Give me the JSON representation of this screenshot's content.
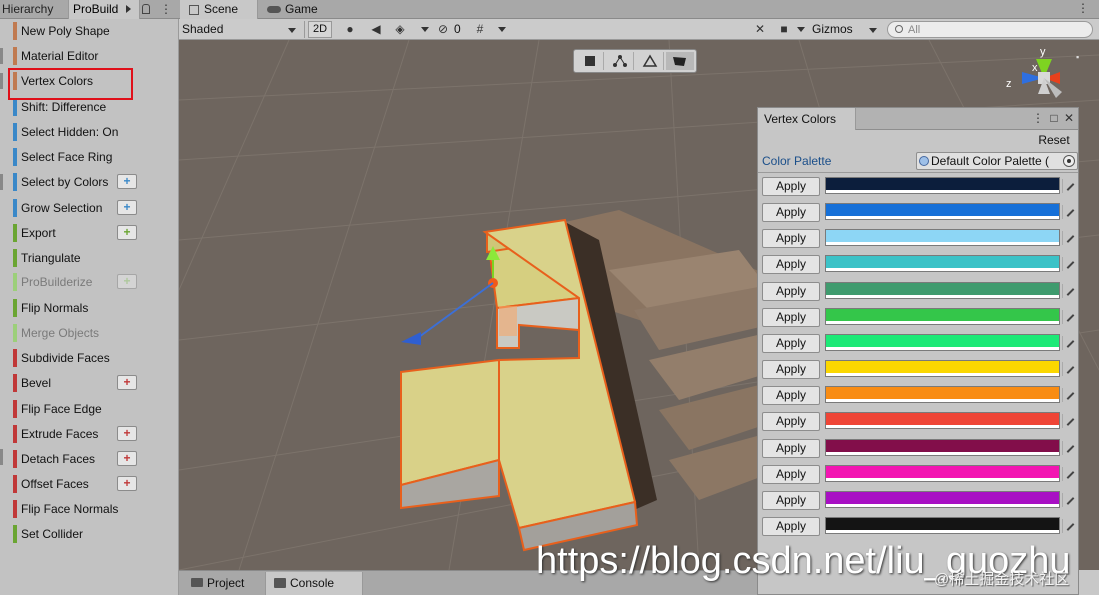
{
  "left_panel": {
    "tabs": {
      "hierarchy": "Hierarchy",
      "probuilder": "ProBuild"
    },
    "items": [
      {
        "label": "New Poly Shape",
        "color": "#c07a50",
        "dim": false,
        "plus": false
      },
      {
        "label": "Material Editor",
        "color": "#c07a50",
        "dim": false,
        "plus": false
      },
      {
        "label": "Vertex Colors",
        "color": "#c07a50",
        "dim": false,
        "plus": false
      },
      {
        "label": "Shift: Difference",
        "color": "#3a88c8",
        "dim": false,
        "plus": false
      },
      {
        "label": "Select Hidden: On",
        "color": "#3a88c8",
        "dim": false,
        "plus": false
      },
      {
        "label": "Select Face Ring",
        "color": "#3a88c8",
        "dim": false,
        "plus": false
      },
      {
        "label": "Select by Colors",
        "color": "#3a88c8",
        "dim": false,
        "plus": true
      },
      {
        "label": "Grow Selection",
        "color": "#3a88c8",
        "dim": false,
        "plus": true
      },
      {
        "label": "Export",
        "color": "#6aa532",
        "dim": false,
        "plus": true
      },
      {
        "label": "Triangulate",
        "color": "#6aa532",
        "dim": false,
        "plus": false
      },
      {
        "label": "ProBuilderize",
        "color": "#9ccf7a",
        "dim": true,
        "plus": true
      },
      {
        "label": "Flip Normals",
        "color": "#6aa532",
        "dim": false,
        "plus": false
      },
      {
        "label": "Merge Objects",
        "color": "#9ccf7a",
        "dim": true,
        "plus": false
      },
      {
        "label": "Subdivide Faces",
        "color": "#c03838",
        "dim": false,
        "plus": false
      },
      {
        "label": "Bevel",
        "color": "#c03838",
        "dim": false,
        "plus": true
      },
      {
        "label": "Flip Face Edge",
        "color": "#c03838",
        "dim": false,
        "plus": false
      },
      {
        "label": "Extrude Faces",
        "color": "#c03838",
        "dim": false,
        "plus": true
      },
      {
        "label": "Detach Faces",
        "color": "#c03838",
        "dim": false,
        "plus": true
      },
      {
        "label": "Offset Faces",
        "color": "#c03838",
        "dim": false,
        "plus": true
      },
      {
        "label": "Flip Face Normals",
        "color": "#c03838",
        "dim": false,
        "plus": false
      },
      {
        "label": "Set Collider",
        "color": "#6aa532",
        "dim": false,
        "plus": false
      }
    ],
    "plus_symbol": "+"
  },
  "scene": {
    "tabs": {
      "scene": "Scene",
      "game": "Game"
    },
    "toolbar": {
      "shading_mode": "Shaded",
      "mode_2d": "2D",
      "hidden_count": "0",
      "gizmos": "Gizmos",
      "search_placeholder": "All"
    },
    "orientation_labels": {
      "y": "y",
      "x": "x",
      "z": "z"
    }
  },
  "vertex_colors": {
    "title": "Vertex Colors",
    "reset_label": "Reset",
    "palette_label": "Color Palette",
    "palette_value": "Default Color Palette (",
    "apply_label": "Apply",
    "colors": [
      "#0c1e3c",
      "#1670d8",
      "#8dd6f5",
      "#3cc2c7",
      "#3f9b6e",
      "#34c64a",
      "#1de977",
      "#fbd700",
      "#f98c13",
      "#ef4536",
      "#820e4a",
      "#f315b2",
      "#a80fc4",
      "#141414"
    ]
  },
  "bottom_tabs": {
    "project": "Project",
    "console": "Console"
  },
  "watermark": {
    "url": "https://blog.csdn.net/liu_guozhu",
    "community": "@稀土掘金技术社区"
  }
}
